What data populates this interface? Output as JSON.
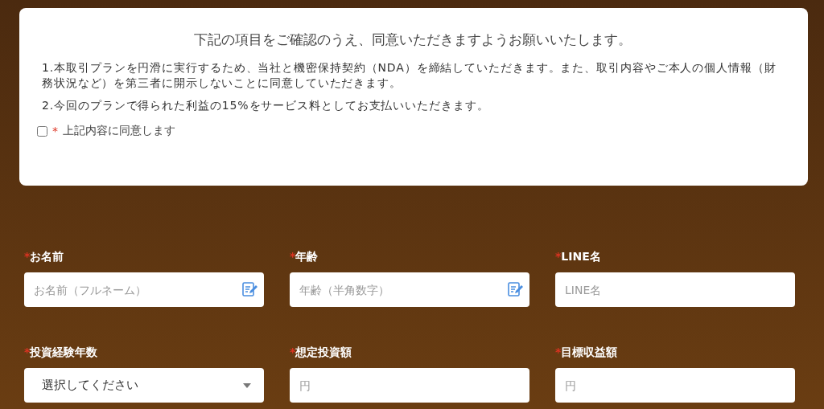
{
  "agreement": {
    "title": "下記の項目をご確認のうえ、同意いただきますようお願いいたします。",
    "terms": [
      "1.本取引プランを円滑に実行するため、当社と機密保持契約（NDA）を締結していただきます。また、取引内容やご本人の個人情報（財務状況など）を第三者に開示しないことに同意していただきます。",
      "2.今回のプランで得られた利益の15%をサービス料としてお支払いいただきます。"
    ],
    "consent": {
      "checked": false,
      "mark": "*",
      "label": "上記内容に同意します"
    }
  },
  "fields": [
    {
      "kind": "text",
      "mark": "*",
      "label": "お名前",
      "placeholder": "お名前（フルネーム）",
      "edit_icon": true
    },
    {
      "kind": "text",
      "mark": "*",
      "label": "年齢",
      "placeholder": "年齢（半角数字）",
      "edit_icon": true
    },
    {
      "kind": "text",
      "mark": "*",
      "label": "LINE名",
      "placeholder": "LINE名",
      "edit_icon": false
    },
    {
      "kind": "select",
      "mark": "*",
      "label": "投資経験年数",
      "value": "選択してください"
    },
    {
      "kind": "text",
      "mark": "*",
      "label": "想定投資額",
      "placeholder": "円",
      "edit_icon": false
    },
    {
      "kind": "text",
      "mark": "*",
      "label": "目標収益額",
      "placeholder": "円",
      "edit_icon": false
    }
  ]
}
